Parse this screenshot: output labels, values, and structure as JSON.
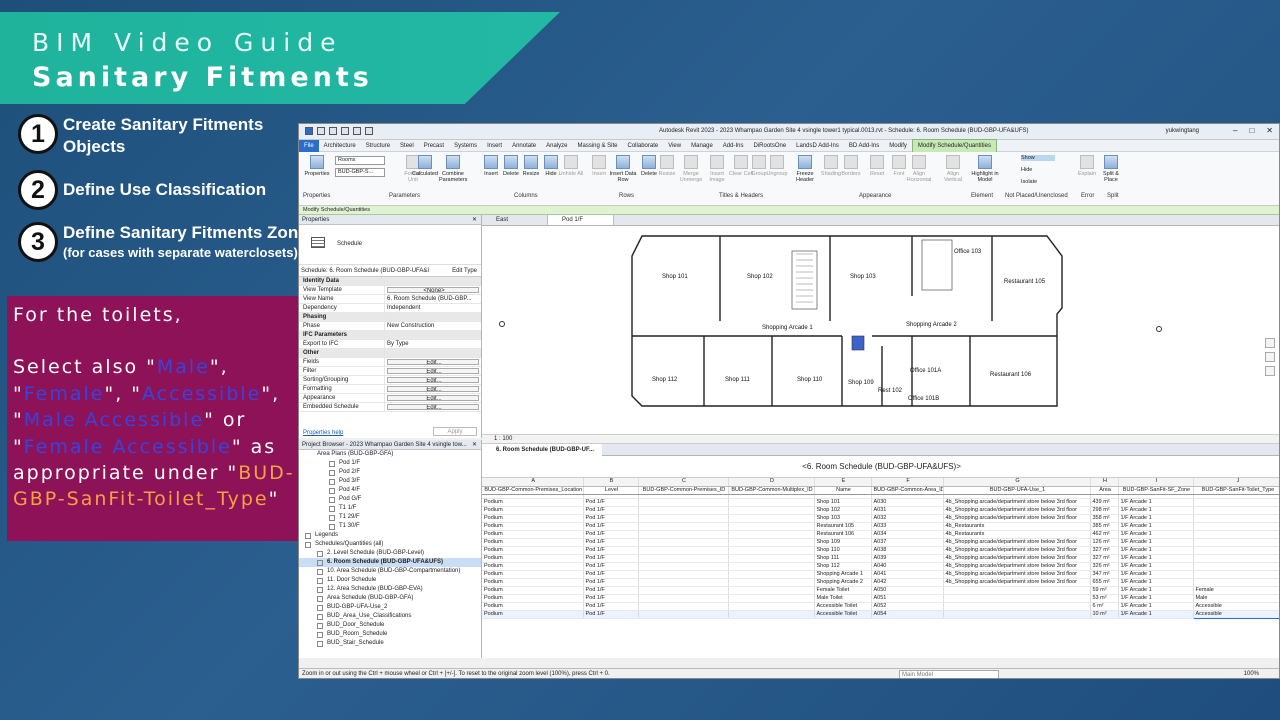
{
  "banner": {
    "line1": "BIM Video Guide",
    "line2": "Sanitary Fitments"
  },
  "steps": [
    {
      "num": "1",
      "text": "Create Sanitary Fitments Objects",
      "sub": ""
    },
    {
      "num": "2",
      "text": "Define Use Classification",
      "sub": ""
    },
    {
      "num": "3",
      "text": "Define Sanitary Fitments Zone",
      "sub": "(for cases with separate waterclosets)"
    }
  ],
  "callout": {
    "p1": "For the toilets,",
    "p2a": "Select also \"",
    "male": "Male",
    "p2b": "\", \"",
    "female": "Female",
    "p2c": "\", \"",
    "accessible": "Accessible",
    "p2d": "\", \"",
    "male_acc": "Male Accessible",
    "p2e": "\" or \"",
    "female_acc": "Female Accessible",
    "p2f": "\" as appropriate under \"",
    "param": "BUD-GBP-SanFit-Toilet_Type",
    "p2g": "\""
  },
  "revit": {
    "title": "Autodesk Revit 2023 - 2023 Whampao Garden Site 4 vsingle tower1 typical.0013.rvt - Schedule: 6. Room Schedule (BUD-GBP-UFA&UFS)",
    "user": "yukwingtang",
    "window_controls": [
      "–",
      "□",
      "✕"
    ],
    "tabs": [
      "File",
      "Architecture",
      "Structure",
      "Steel",
      "Precast",
      "Systems",
      "Insert",
      "Annotate",
      "Analyze",
      "Massing & Site",
      "Collaborate",
      "View",
      "Manage",
      "Add-Ins",
      "DiRootsOne",
      "LandsD Add-Ins",
      "BD Add-Ins",
      "Modify",
      "Modify Schedule/Quantities"
    ],
    "ribbon": {
      "selector1": "Rooms",
      "selector2": "BUD-GBP-S...",
      "buttons": [
        {
          "label": "Properties",
          "dis": false
        },
        {
          "label": "Format Unit",
          "dis": true
        },
        {
          "label": "Calculated",
          "dis": false
        },
        {
          "label": "Combine Parameters",
          "dis": false
        },
        {
          "label": "Insert",
          "dis": false
        },
        {
          "label": "Delete",
          "dis": false
        },
        {
          "label": "Resize",
          "dis": false
        },
        {
          "label": "Hide",
          "dis": false
        },
        {
          "label": "Unhide All",
          "dis": true
        },
        {
          "label": "Insert",
          "dis": true
        },
        {
          "label": "Insert Data Row",
          "dis": false
        },
        {
          "label": "Delete",
          "dis": false
        },
        {
          "label": "Resize",
          "dis": true
        },
        {
          "label": "Merge Unmerge",
          "dis": true
        },
        {
          "label": "Insert Image",
          "dis": true
        },
        {
          "label": "Clear Cell",
          "dis": true
        },
        {
          "label": "Group",
          "dis": true
        },
        {
          "label": "Ungroup",
          "dis": true
        },
        {
          "label": "Freeze Header",
          "dis": false
        },
        {
          "label": "Shading",
          "dis": true
        },
        {
          "label": "Borders",
          "dis": true
        },
        {
          "label": "Reset",
          "dis": true
        },
        {
          "label": "Font",
          "dis": true
        },
        {
          "label": "Align Horizontal",
          "dis": true
        },
        {
          "label": "Align Vertical",
          "dis": true
        },
        {
          "label": "Highlight in Model",
          "dis": false
        },
        {
          "label": "Show",
          "dis": false
        },
        {
          "label": "Hide",
          "dis": false
        },
        {
          "label": "Isolate",
          "dis": false
        },
        {
          "label": "Explain",
          "dis": true
        },
        {
          "label": "Split & Place",
          "dis": false
        }
      ],
      "groups": [
        "Properties",
        "Parameters",
        "Columns",
        "Rows",
        "Titles & Headers",
        "Appearance",
        "Element",
        "Not Placed/Unenclosed",
        "Error",
        "Split"
      ]
    },
    "context_bar": "Modify Schedule/Quantities",
    "properties": {
      "header": "Properties",
      "type_name": "Schedule",
      "selector": "Schedule: 6. Room Schedule (BUD-GBP-UFA&I",
      "edit_type": "Edit Type",
      "rows": [
        {
          "k": "Identity Data",
          "v": "",
          "cat": true
        },
        {
          "k": "View Template",
          "v": "<None>",
          "btn": true
        },
        {
          "k": "View Name",
          "v": "6. Room Schedule (BUD-GBP..."
        },
        {
          "k": "Dependency",
          "v": "Independent"
        },
        {
          "k": "Phasing",
          "v": "",
          "cat": true
        },
        {
          "k": "Phase",
          "v": "New Construction"
        },
        {
          "k": "IFC Parameters",
          "v": "",
          "cat": true
        },
        {
          "k": "Export to IFC",
          "v": "By Type"
        },
        {
          "k": "Other",
          "v": "",
          "cat": true
        },
        {
          "k": "Fields",
          "v": "Edit...",
          "btn": true
        },
        {
          "k": "Filter",
          "v": "Edit...",
          "btn": true
        },
        {
          "k": "Sorting/Grouping",
          "v": "Edit...",
          "btn": true
        },
        {
          "k": "Formatting",
          "v": "Edit...",
          "btn": true
        },
        {
          "k": "Appearance",
          "v": "Edit...",
          "btn": true
        },
        {
          "k": "Embedded Schedule",
          "v": "Edit...",
          "btn": true
        }
      ],
      "help": "Properties help",
      "apply": "Apply"
    },
    "browser": {
      "header": "Project Browser - 2023 Whampao Garden Site 4 vsingle tow...",
      "items": [
        {
          "t": "Area Plans (BUD-GBP-GFA)",
          "lvl": 1,
          "chk": false
        },
        {
          "t": "Pod 1/F",
          "lvl": 2,
          "chk": true
        },
        {
          "t": "Pod 2/F",
          "lvl": 2,
          "chk": true
        },
        {
          "t": "Pod 3/F",
          "lvl": 2,
          "chk": true
        },
        {
          "t": "Pod 4/F",
          "lvl": 2,
          "chk": true
        },
        {
          "t": "Pod G/F",
          "lvl": 2,
          "chk": true
        },
        {
          "t": "T1 1/F",
          "lvl": 2,
          "chk": true
        },
        {
          "t": "T1 29/F",
          "lvl": 2,
          "chk": true
        },
        {
          "t": "T1 30/F",
          "lvl": 2,
          "chk": true
        },
        {
          "t": "Legends",
          "lvl": 0,
          "chk": true
        },
        {
          "t": "Schedules/Quantities (all)",
          "lvl": 0,
          "chk": true
        },
        {
          "t": "2. Level Schedule (BUD-GBP-Level)",
          "lvl": 1,
          "chk": true
        },
        {
          "t": "6. Room Schedule (BUD-GBP-UFA&UFS)",
          "lvl": 1,
          "chk": true,
          "sel": true
        },
        {
          "t": "10. Area Schedule (BUD-GBP-Compartmentation)",
          "lvl": 1,
          "chk": true
        },
        {
          "t": "11. Door Schedule",
          "lvl": 1,
          "chk": true
        },
        {
          "t": "12. Area Schedule (BUD-GBP-EVA)",
          "lvl": 1,
          "chk": true
        },
        {
          "t": "Area Schedule (BUD-GBP-GFA)",
          "lvl": 1,
          "chk": true
        },
        {
          "t": "BUD-GBP-UFA-Use_2",
          "lvl": 1,
          "chk": true
        },
        {
          "t": "BUD_Area_Use_Classifications",
          "lvl": 1,
          "chk": true
        },
        {
          "t": "BUD_Door_Schedule",
          "lvl": 1,
          "chk": true
        },
        {
          "t": "BUD_Room_Schedule",
          "lvl": 1,
          "chk": true
        },
        {
          "t": "BUD_Stair_Schedule",
          "lvl": 1,
          "chk": true
        }
      ]
    },
    "view_tabs": [
      "East",
      "Pod 1/F"
    ],
    "plan": {
      "rooms": [
        "Shop 101",
        "Shop 102",
        "Shop 103",
        "Office 103",
        "Restaurant 105",
        "Shopping Arcade 1",
        "Shopping Arcade 2",
        "Shop 112",
        "Shop 111",
        "Shop 110",
        "Shop 109",
        "Office 101A",
        "Restaurant 106",
        "Rest 102",
        "Office 101B"
      ],
      "scale": "1 : 100"
    },
    "schedule": {
      "tab": "6. Room Schedule (BUD-GBP-UF...",
      "title": "<6. Room Schedule (BUD-GBP-UFA&UFS)>",
      "letters": [
        "A",
        "B",
        "C",
        "D",
        "E",
        "F",
        "G",
        "H",
        "I",
        "J"
      ],
      "headers": [
        "BUD-GBP-Common-Premises_Location",
        "Level",
        "BUD-GBP-Common-Premises_ID",
        "BUD-GBP-Common-Multiplex_ID",
        "Name",
        "BUD-GBP-Common-Area_ID",
        "BUD-GBP-UFA-Use_1",
        "Area",
        "BUD-GBP-SanFit-SF_Zone",
        "BUD-GBP-SanFit-Toilet_Type"
      ],
      "rows": [
        [
          "Podium",
          "Pod 1/F",
          "",
          "",
          "Shop 101",
          "A030",
          "4b_Shopping arcade/department store below 3rd floor",
          "439 m²",
          "1/F Arcade 1",
          ""
        ],
        [
          "Podium",
          "Pod 1/F",
          "",
          "",
          "Shop 102",
          "A031",
          "4b_Shopping arcade/department store below 3rd floor",
          "298 m²",
          "1/F Arcade 1",
          ""
        ],
        [
          "Podium",
          "Pod 1/F",
          "",
          "",
          "Shop 103",
          "A032",
          "4b_Shopping arcade/department store below 3rd floor",
          "358 m²",
          "1/F Arcade 1",
          ""
        ],
        [
          "Podium",
          "Pod 1/F",
          "",
          "",
          "Restaurant 105",
          "A033",
          "4b_Restaurants",
          "385 m²",
          "1/F Arcade 1",
          ""
        ],
        [
          "Podium",
          "Pod 1/F",
          "",
          "",
          "Restaurant 106",
          "A034",
          "4b_Restaurants",
          "462 m²",
          "1/F Arcade 1",
          ""
        ],
        [
          "Podium",
          "Pod 1/F",
          "",
          "",
          "Shop 109",
          "A037",
          "4b_Shopping arcade/department store below 3rd floor",
          "126 m²",
          "1/F Arcade 1",
          ""
        ],
        [
          "Podium",
          "Pod 1/F",
          "",
          "",
          "Shop 110",
          "A038",
          "4b_Shopping arcade/department store below 3rd floor",
          "327 m²",
          "1/F Arcade 1",
          ""
        ],
        [
          "Podium",
          "Pod 1/F",
          "",
          "",
          "Shop 111",
          "A039",
          "4b_Shopping arcade/department store below 3rd floor",
          "327 m²",
          "1/F Arcade 1",
          ""
        ],
        [
          "Podium",
          "Pod 1/F",
          "",
          "",
          "Shop 112",
          "A040",
          "4b_Shopping arcade/department store below 3rd floor",
          "326 m²",
          "1/F Arcade 1",
          ""
        ],
        [
          "Podium",
          "Pod 1/F",
          "",
          "",
          "Shopping Arcade 1",
          "A041",
          "4b_Shopping arcade/department store below 3rd floor",
          "347 m²",
          "1/F Arcade 1",
          ""
        ],
        [
          "Podium",
          "Pod 1/F",
          "",
          "",
          "Shopping Arcade 2",
          "A042",
          "4b_Shopping arcade/department store below 3rd floor",
          "655 m²",
          "1/F Arcade 1",
          ""
        ],
        [
          "Podium",
          "Pod 1/F",
          "",
          "",
          "Female Toilet",
          "A050",
          "",
          "59 m²",
          "1/F Arcade 1",
          "Female"
        ],
        [
          "Podium",
          "Pod 1/F",
          "",
          "",
          "Male Toilet",
          "A051",
          "",
          "53 m²",
          "1/F Arcade 1",
          "Male"
        ],
        [
          "Podium",
          "Pod 1/F",
          "",
          "",
          "Accessible Toilet",
          "A052",
          "",
          "6 m²",
          "1/F Arcade 1",
          "Accessible"
        ],
        [
          "Podium",
          "Pod 1/F",
          "",
          "",
          "Accessible Toilet",
          "A054",
          "",
          "10 m²",
          "1/F Arcade 1",
          "Accessible"
        ]
      ]
    },
    "status": {
      "hint": "Zoom in or out using the Ctrl + mouse wheel or Ctrl + [+/-]. To reset to the original zoom level (100%), press Ctrl + 0.",
      "model": "Main Model",
      "zoom": "100%"
    }
  }
}
